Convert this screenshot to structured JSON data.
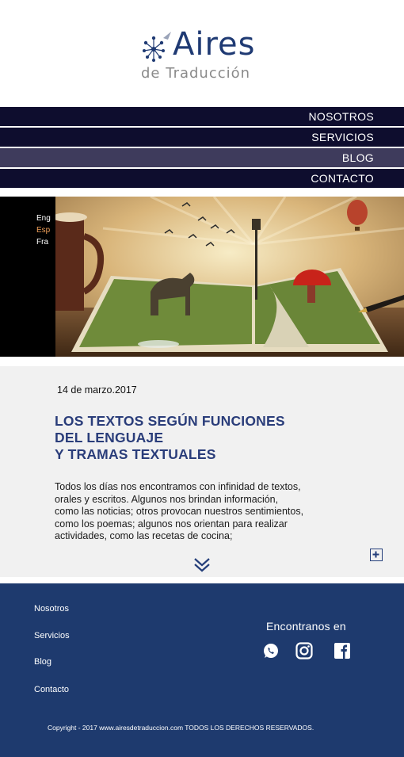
{
  "brand": {
    "title": "Aires",
    "subtitle": "de Traducción",
    "icon": "dandelion-logo-icon",
    "color": "#1f3a73"
  },
  "nav": {
    "items": [
      {
        "label": "NOSOTROS",
        "active": false
      },
      {
        "label": "SERVICIOS",
        "active": false
      },
      {
        "label": "BLOG",
        "active": true
      },
      {
        "label": "CONTACTO",
        "active": false
      }
    ],
    "bg": "#0e0d2e",
    "active_bg": "#3e3b5c"
  },
  "languages": [
    {
      "label": "Eng",
      "active": false
    },
    {
      "label": "Esp",
      "active": true
    },
    {
      "label": "Fra",
      "active": false
    }
  ],
  "article": {
    "date": "14 de marzo.2017",
    "title_lines": [
      "LOS TEXTOS SEGÚN FUNCIONES",
      "DEL LENGUAJE",
      "Y TRAMAS TEXTUALES"
    ],
    "body_lines": [
      "Todos los días nos encontramos con infinidad de textos,",
      "orales y escritos. Algunos nos brindan información,",
      "como las noticias; otros provocan nuestros sentimientos,",
      "como los poemas; algunos nos orientan para realizar",
      "actividades, como las recetas de cocina;"
    ],
    "expand_icon": "plus-square-icon",
    "more_icon": "double-chevron-down-icon"
  },
  "footer": {
    "links": [
      "Nosotros",
      "Servicios",
      "Blog",
      "Contacto"
    ],
    "social_label": "Encontranos en",
    "social_icons": [
      "whatsapp-icon",
      "instagram-icon",
      "facebook-icon"
    ],
    "copyright": "Copyright - 2017 www.airesdetraduccion.com TODOS LOS DERECHOS RESERVADOS.",
    "bg": "#1e3a6e"
  }
}
